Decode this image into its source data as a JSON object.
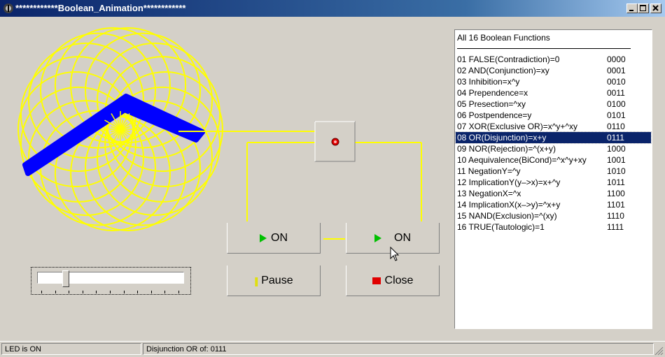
{
  "window": {
    "title": "************Boolean_Animation************",
    "icon": "app-icon",
    "controls": [
      "minimize-icon",
      "maximize-icon",
      "close-icon"
    ]
  },
  "buttons": {
    "on_left": "ON",
    "on_right": "ON",
    "pause": "Pause",
    "close": "Close"
  },
  "slider": {
    "position": 0.17
  },
  "list": {
    "header": "All 16 Boolean Functions",
    "selected_index": 7,
    "items": [
      {
        "label": "01 FALSE(Contradiction)=0",
        "code": "0000"
      },
      {
        "label": "02 AND(Conjunction)=xy",
        "code": "0001"
      },
      {
        "label": "03 Inhibition=x^y",
        "code": "0010"
      },
      {
        "label": "04 Prependence=x",
        "code": "0011"
      },
      {
        "label": "05 Presection=^xy",
        "code": "0100"
      },
      {
        "label": "06 Postpendence=y",
        "code": "0101"
      },
      {
        "label": "07 XOR(Exclusive OR)=x^y+^xy",
        "code": "0110"
      },
      {
        "label": "08 OR(Disjunction)=x+y",
        "code": "0111"
      },
      {
        "label": "09 NOR(Rejection)=^(x+y)",
        "code": "1000"
      },
      {
        "label": "10 Aequivalence(BiCond)=^x^y+xy",
        "code": "1001"
      },
      {
        "label": "11 NegationY=^y",
        "code": "1010"
      },
      {
        "label": "12 ImplicationY(y–>x)=x+^y",
        "code": "1011"
      },
      {
        "label": "13 NegationX=^x",
        "code": "1100"
      },
      {
        "label": "14 ImplicationX(x–>y)=^x+y",
        "code": "1101"
      },
      {
        "label": "15 NAND(Exclusion)=^(xy)",
        "code": "1110"
      },
      {
        "label": "16 TRUE(Tautologic)=1",
        "code": "1111"
      }
    ]
  },
  "status": {
    "left": "LED is ON",
    "right": "Disjunction OR of: 0111"
  },
  "colors": {
    "wire": "#ffff00",
    "shape": "#0000ff",
    "selection": "#0a246a",
    "led": "#e00000"
  }
}
